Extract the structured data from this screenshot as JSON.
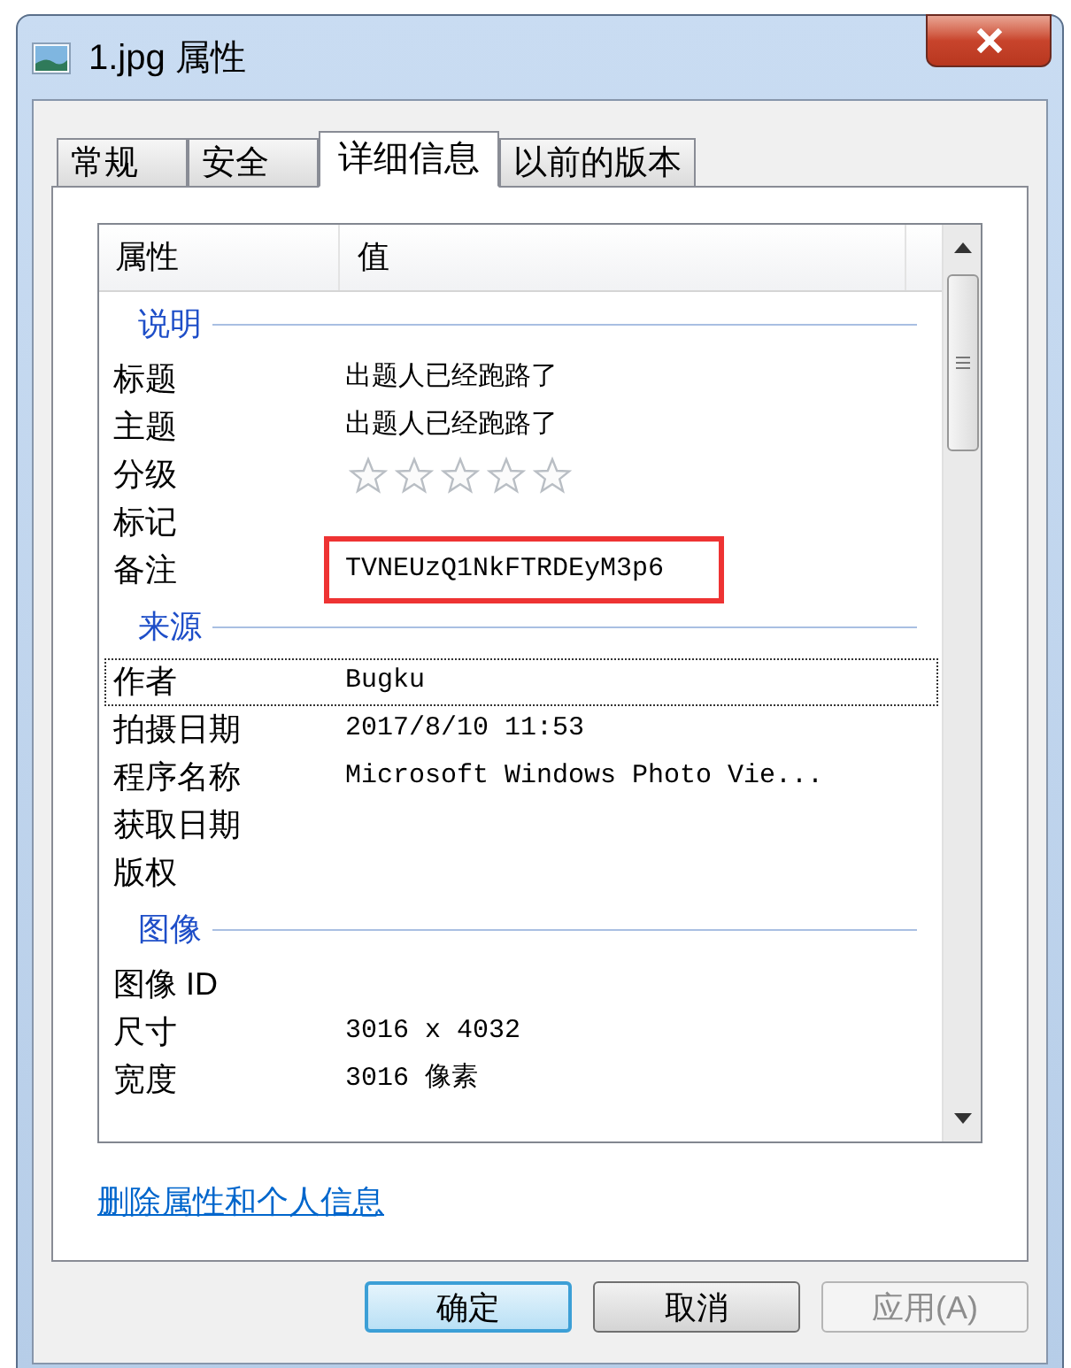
{
  "window": {
    "title": "1.jpg 属性"
  },
  "tabs": [
    {
      "label": "常规",
      "selected": false
    },
    {
      "label": "安全",
      "selected": false
    },
    {
      "label": "详细信息",
      "selected": true
    },
    {
      "label": "以前的版本",
      "selected": false
    }
  ],
  "table": {
    "columns": [
      "属性",
      "值"
    ],
    "sections": [
      {
        "title": "说明",
        "rows": [
          {
            "property": "标题",
            "kind": "text",
            "value": "出题人已经跑路了",
            "focused": false,
            "highlighted": false
          },
          {
            "property": "主题",
            "kind": "text",
            "value": "出题人已经跑路了",
            "focused": false,
            "highlighted": false
          },
          {
            "property": "分级",
            "kind": "rating",
            "stars": 0,
            "focused": false,
            "highlighted": false
          },
          {
            "property": "标记",
            "kind": "text",
            "focused": false,
            "highlighted": false
          },
          {
            "property": "备注",
            "kind": "text",
            "value": "TVNEUzQ1NkFTRDEyM3p6",
            "focused": false,
            "highlighted": true
          }
        ]
      },
      {
        "title": "来源",
        "rows": [
          {
            "property": "作者",
            "kind": "text",
            "value": "Bugku",
            "focused": true,
            "highlighted": false
          },
          {
            "property": "拍摄日期",
            "kind": "text",
            "value": "2017/8/10 11:53",
            "focused": false,
            "highlighted": false
          },
          {
            "property": "程序名称",
            "kind": "text",
            "value": "Microsoft Windows Photo Vie...",
            "focused": false,
            "highlighted": false
          },
          {
            "property": "获取日期",
            "kind": "text",
            "focused": false,
            "highlighted": false
          },
          {
            "property": "版权",
            "kind": "text",
            "focused": false,
            "highlighted": false
          }
        ]
      },
      {
        "title": "图像",
        "rows": [
          {
            "property": "图像 ID",
            "kind": "text",
            "focused": false,
            "highlighted": false
          },
          {
            "property": "尺寸",
            "kind": "text",
            "value": "3016 x 4032",
            "focused": false,
            "highlighted": false
          },
          {
            "property": "宽度",
            "kind": "text",
            "value": "3016 像素",
            "focused": false,
            "highlighted": false
          }
        ]
      }
    ]
  },
  "remove_link": "删除属性和个人信息",
  "buttons": [
    {
      "label": "确定",
      "default": true,
      "disabled": false
    },
    {
      "label": "取消",
      "default": false,
      "disabled": false
    },
    {
      "label": "应用(A)",
      "default": false,
      "disabled": true
    }
  ]
}
